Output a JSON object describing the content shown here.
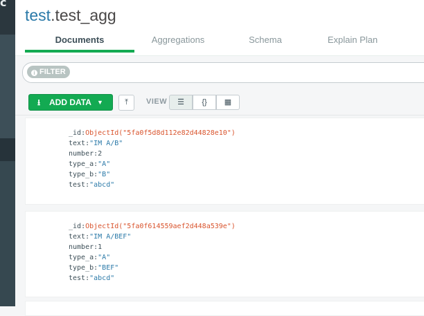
{
  "sidebar": {
    "glyph": "c"
  },
  "header": {
    "title_db": "test",
    "title_dot": ".",
    "title_coll": "test_agg",
    "tabs": [
      {
        "label": "Documents",
        "active": true
      },
      {
        "label": "Aggregations",
        "active": false
      },
      {
        "label": "Schema",
        "active": false
      },
      {
        "label": "Explain Plan",
        "active": false
      }
    ]
  },
  "filter": {
    "pill_label": "FILTER",
    "value": ""
  },
  "toolbar": {
    "add_data_label": "ADD DATA",
    "view_label": "VIEW",
    "view_modes": [
      {
        "name": "list",
        "glyph": "☰",
        "active": true
      },
      {
        "name": "json",
        "glyph": "{}",
        "active": false
      },
      {
        "name": "table",
        "glyph": "▦",
        "active": false
      }
    ]
  },
  "documents": [
    {
      "fields": [
        {
          "key": "_id",
          "value": "ObjectId(\"5fa0f5d8d112e82d44828e10\")",
          "kind": "oid"
        },
        {
          "key": "text",
          "value": "\"IM A/B\"",
          "kind": "str"
        },
        {
          "key": "number",
          "value": "2",
          "kind": "num"
        },
        {
          "key": "type_a",
          "value": "\"A\"",
          "kind": "str"
        },
        {
          "key": "type_b",
          "value": "\"B\"",
          "kind": "str"
        },
        {
          "key": "test",
          "value": "\"abcd\"",
          "kind": "str"
        }
      ]
    },
    {
      "fields": [
        {
          "key": "_id",
          "value": "ObjectId(\"5fa0f614559aef2d448a539e\")",
          "kind": "oid"
        },
        {
          "key": "text",
          "value": "\"IM A/BEF\"",
          "kind": "str"
        },
        {
          "key": "number",
          "value": "1",
          "kind": "num"
        },
        {
          "key": "type_a",
          "value": "\"A\"",
          "kind": "str"
        },
        {
          "key": "type_b",
          "value": "\"BEF\"",
          "kind": "str"
        },
        {
          "key": "test",
          "value": "\"abcd\"",
          "kind": "str"
        }
      ]
    }
  ]
}
